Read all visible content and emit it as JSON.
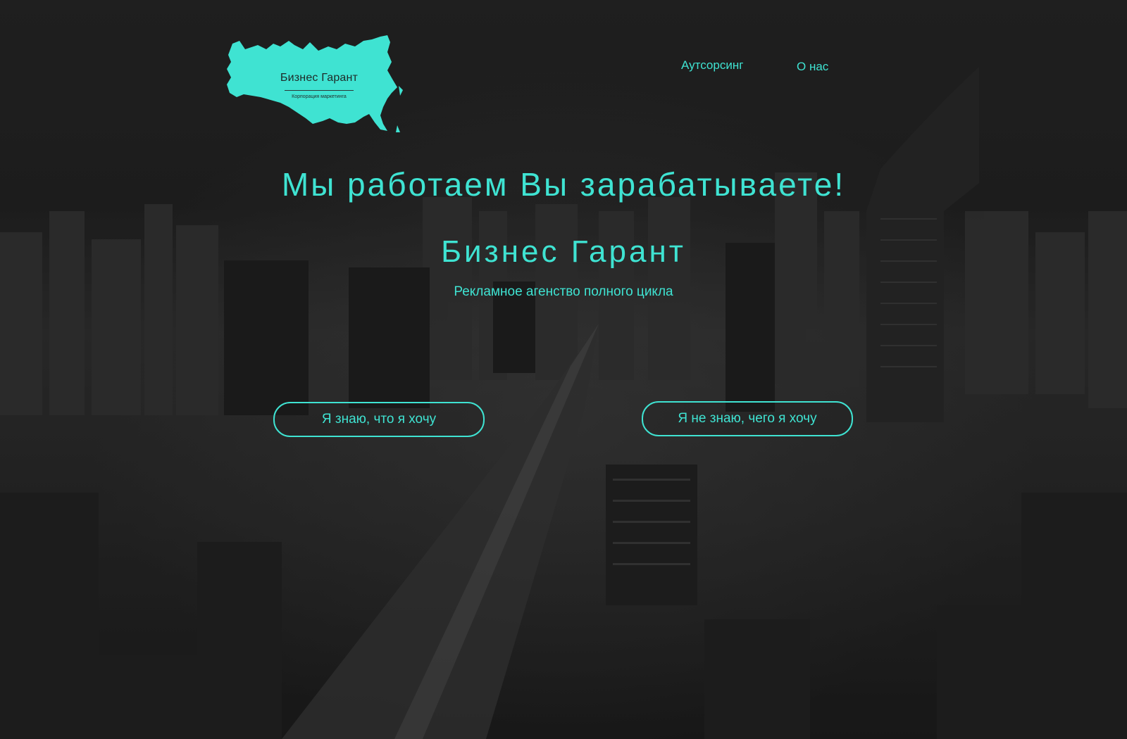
{
  "logo": {
    "title": "Бизнес Гарант",
    "subtitle": "Корпорация маркетинга",
    "icon": "russia-map-icon",
    "color": "#3fe3d2"
  },
  "nav": {
    "items": [
      {
        "label": "Аутсорсинг"
      },
      {
        "label": "О нас"
      }
    ]
  },
  "hero": {
    "headline": "Мы работаем Вы зарабатываете!",
    "brand": "Бизнес Гарант",
    "tagline": "Рекламное агенство полного цикла"
  },
  "buttons": {
    "know": "Я знаю, что я хочу",
    "dont_know": "Я не знаю, чего я хочу"
  },
  "colors": {
    "accent": "#3fe3d2",
    "background": "#1b1b1b"
  }
}
